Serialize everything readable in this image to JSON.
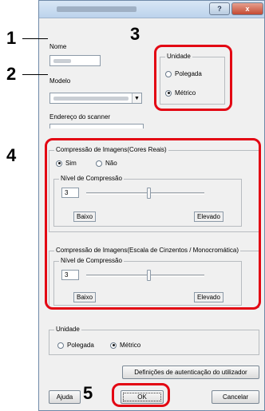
{
  "window": {
    "help_label": "?",
    "close_label": "x"
  },
  "fields": {
    "nome_label": "Nome",
    "modelo_label": "Modelo",
    "endereco_label": "Endereço do scanner"
  },
  "unidade_top": {
    "title": "Unidade",
    "options": [
      "Polegada",
      "Métrico"
    ],
    "selected": "Métrico"
  },
  "compressao_cores": {
    "title": "Compressão de Imagens(Cores Reais)",
    "options": [
      "Sim",
      "Não"
    ],
    "selected": "Sim",
    "nivel_label": "Nível de Compressão",
    "value": "3",
    "low_label": "Baixo",
    "high_label": "Elevado"
  },
  "compressao_cinzentos": {
    "title": "Compressão de Imagens(Escala de Cinzentos / Monocromática)",
    "nivel_label": "Nível de Compressão",
    "value": "3",
    "low_label": "Baixo",
    "high_label": "Elevado"
  },
  "unidade_bottom": {
    "title": "Unidade",
    "options": [
      "Polegada",
      "Métrico"
    ],
    "selected": "Métrico"
  },
  "buttons": {
    "auth": "Definições de autenticação do utilizador",
    "help": "Ajuda",
    "ok": "OK",
    "cancel": "Cancelar"
  },
  "callouts": [
    "1",
    "2",
    "3",
    "4",
    "5"
  ],
  "colors": {
    "callout": "#e30613"
  }
}
